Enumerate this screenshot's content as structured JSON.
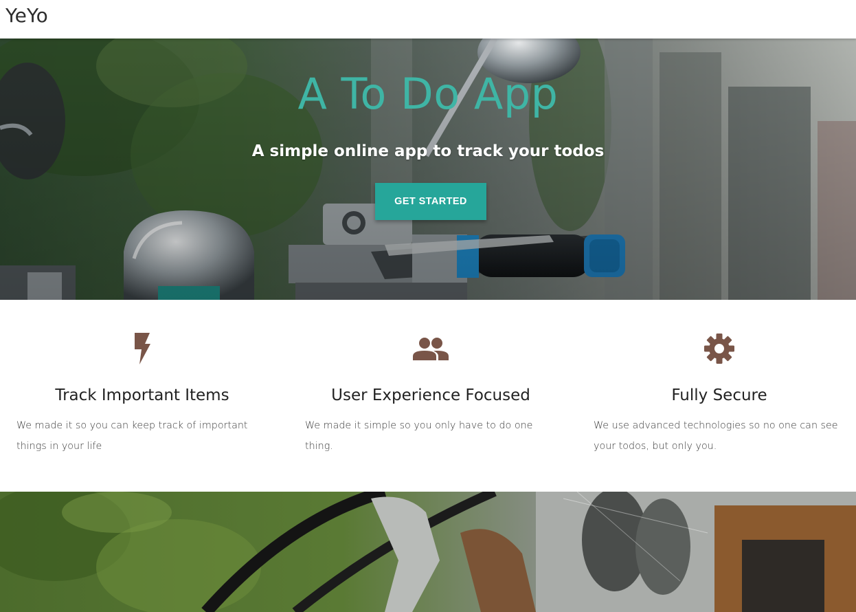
{
  "nav": {
    "brand": "YeYo"
  },
  "hero": {
    "title": "A To Do App",
    "subtitle": "A simple online app to track your todos",
    "cta_label": "GET STARTED"
  },
  "features": [
    {
      "icon": "flash-icon",
      "title": "Track Important Items",
      "text": "We made it so you can keep track of important things in your life"
    },
    {
      "icon": "group-icon",
      "title": "User Experience Focused",
      "text": "We made it simple so you only have to do one thing."
    },
    {
      "icon": "settings-icon",
      "title": "Fully Secure",
      "text": "We use advanced technologies so no one can see your todos, but only you."
    }
  ],
  "colors": {
    "accent": "#26a69a",
    "title_teal": "#3fb5a5",
    "icon_brown": "#795548"
  }
}
